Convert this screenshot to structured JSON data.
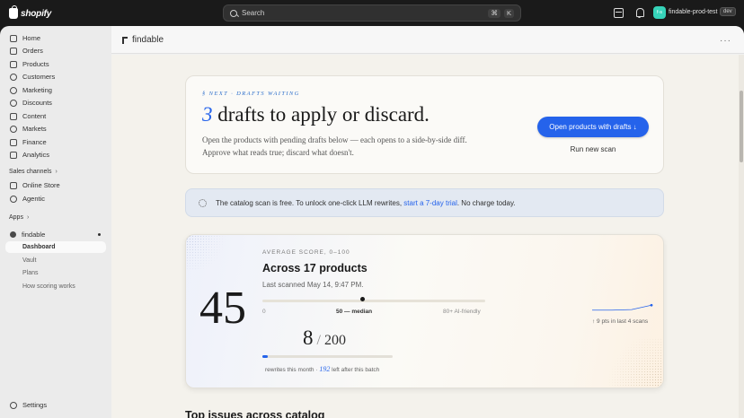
{
  "topbar": {
    "brand": "shopify",
    "search_placeholder": "Search",
    "shortcut_keys": [
      "⌘",
      "K"
    ],
    "store_initials": "f-s",
    "store_name": "findable-prod-test",
    "store_badge": "dev"
  },
  "sidebar": {
    "items": [
      {
        "label": "Home",
        "icon": "home-icon"
      },
      {
        "label": "Orders",
        "icon": "orders-icon"
      },
      {
        "label": "Products",
        "icon": "tag-icon"
      },
      {
        "label": "Customers",
        "icon": "person-icon"
      },
      {
        "label": "Marketing",
        "icon": "target-icon"
      },
      {
        "label": "Discounts",
        "icon": "discount-icon"
      },
      {
        "label": "Content",
        "icon": "content-icon"
      },
      {
        "label": "Markets",
        "icon": "globe-icon"
      },
      {
        "label": "Finance",
        "icon": "bank-icon"
      },
      {
        "label": "Analytics",
        "icon": "chart-icon"
      }
    ],
    "sales_channels_label": "Sales channels",
    "channels": [
      {
        "label": "Online Store",
        "icon": "store-icon"
      },
      {
        "label": "Agentic",
        "icon": "agent-icon"
      }
    ],
    "apps_label": "Apps",
    "app_name": "findable",
    "app_pages": [
      "Dashboard",
      "Vault",
      "Plans",
      "How scoring works"
    ],
    "settings_label": "Settings"
  },
  "app_header": {
    "title": "findable"
  },
  "hero": {
    "eyebrow": "§ NEXT · DRAFTS WAITING",
    "count": "3",
    "title_rest": " drafts to apply or discard.",
    "description": "Open the products with pending drafts below — each opens to a side-by-side diff. Approve what reads true; discard what doesn't.",
    "primary_button": "Open products with drafts ↓",
    "secondary_button": "Run new scan"
  },
  "banner": {
    "text_before": "The catalog scan is free. To unlock one-click LLM rewrites, ",
    "link": "start a 7-day trial",
    "text_after": ". No charge today."
  },
  "score_card": {
    "score": "45",
    "eyebrow": "AVERAGE SCORE, 0–100",
    "title": "Across 17 products",
    "last_scanned": "Last scanned May 14, 9:47 PM.",
    "scale": {
      "min_label": "0",
      "mid_label": "50 — median",
      "max_label": "80+ AI-friendly",
      "value": 45,
      "max": 100
    },
    "rewrites_used": "8",
    "rewrites_total": "200",
    "rewrites_fraction": 0.04,
    "quota_text_before": "rewrites this month · ",
    "quota_remaining": "192",
    "quota_text_after": " left after this batch",
    "trend_note": "↑ 9 pts in last 4 scans",
    "trend_values": [
      36,
      36,
      37,
      45
    ],
    "accent_color": "#2563eb"
  },
  "next_section": {
    "heading": "Top issues across catalog"
  }
}
